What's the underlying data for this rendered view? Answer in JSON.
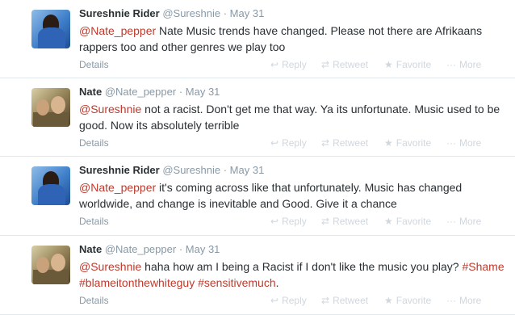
{
  "tweets": [
    {
      "name": "Sureshnie Rider",
      "handle": "@Sureshnie",
      "separator": "·",
      "time": "May 31",
      "text_parts": [
        {
          "t": "@Nate_pepper",
          "k": "mention"
        },
        {
          "t": " Nate Music trends have changed. Please not there are Afrikaans rappers too and other genres we play too",
          "k": "plain"
        }
      ],
      "avatar": "woman-blue-avatar"
    },
    {
      "name": "Nate",
      "handle": "@Nate_pepper",
      "separator": "·",
      "time": "May 31",
      "text_parts": [
        {
          "t": "@Sureshnie",
          "k": "mention"
        },
        {
          "t": " not a racist. Don't get me that way. Ya its unfortunate. Music used to be good. Now its absolutely terrible",
          "k": "plain"
        }
      ],
      "avatar": "group-photo-avatar"
    },
    {
      "name": "Sureshnie Rider",
      "handle": "@Sureshnie",
      "separator": "·",
      "time": "May 31",
      "text_parts": [
        {
          "t": "@Nate_pepper",
          "k": "mention"
        },
        {
          "t": " it's coming across like that unfortunately. Music has changed worldwide, and change is inevitable and Good. Give it a chance",
          "k": "plain"
        }
      ],
      "avatar": "woman-blue-avatar"
    },
    {
      "name": "Nate",
      "handle": "@Nate_pepper",
      "separator": "·",
      "time": "May 31",
      "text_parts": [
        {
          "t": "@Sureshnie",
          "k": "mention"
        },
        {
          "t": " haha how am I being a Racist if I don't like the music you play? ",
          "k": "plain"
        },
        {
          "t": "#Shame",
          "k": "hashtag"
        },
        {
          "t": " ",
          "k": "plain"
        },
        {
          "t": "#blameitonthewhiteguy",
          "k": "hashtag"
        },
        {
          "t": " ",
          "k": "plain"
        },
        {
          "t": "#sensitivemuch",
          "k": "hashtag"
        },
        {
          "t": ".",
          "k": "plain"
        }
      ],
      "avatar": "group-photo-avatar"
    }
  ],
  "actions": {
    "details": "Details",
    "reply": "Reply",
    "retweet": "Retweet",
    "favorite": "Favorite",
    "more": "More",
    "reply_icon": "↩",
    "retweet_icon": "⇄",
    "favorite_icon": "★",
    "more_icon": "···"
  },
  "colors": {
    "link": "#c0392b",
    "muted": "#8899a6",
    "action_faded": "#d0d7dd"
  }
}
